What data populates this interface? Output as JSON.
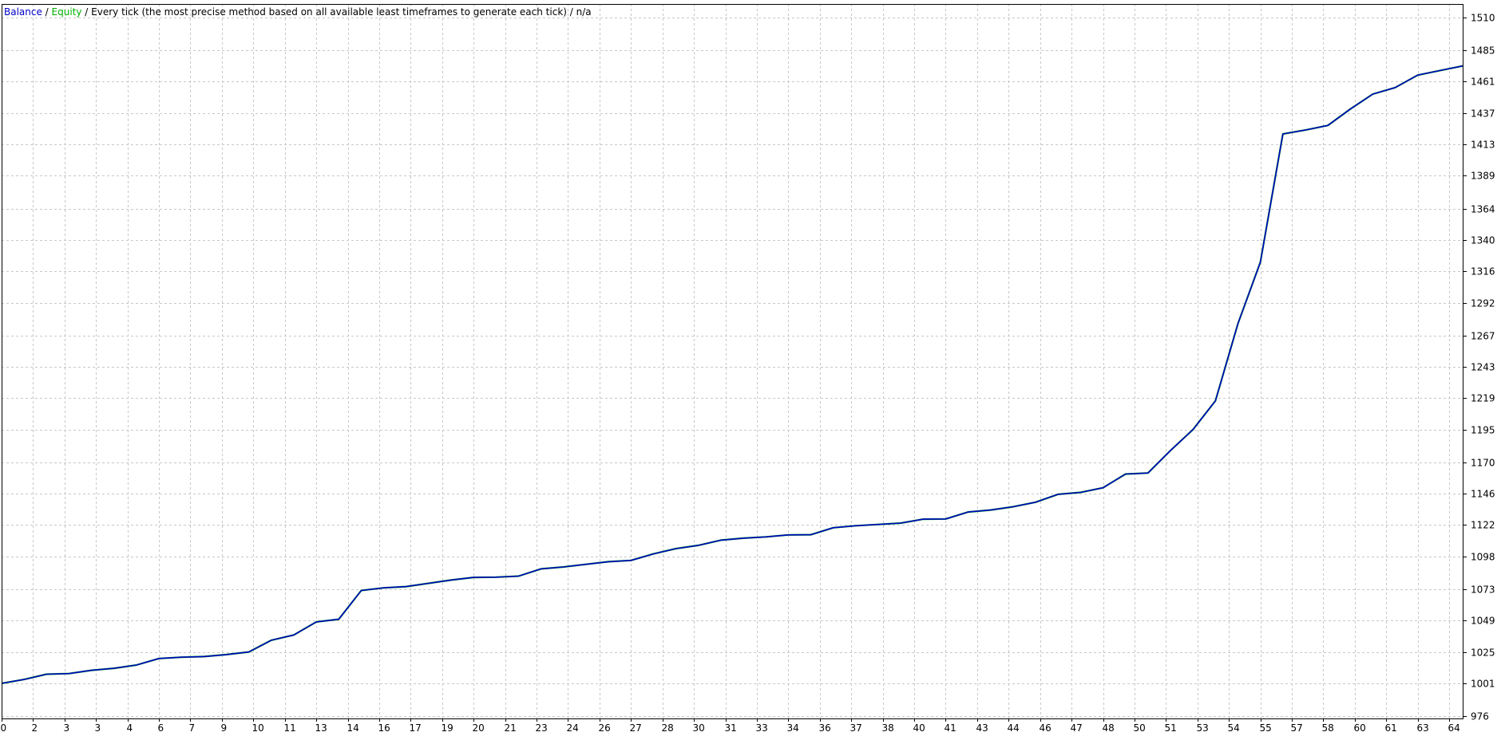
{
  "legend": {
    "balance_label": "Balance",
    "equity_label": "Equity",
    "separator": " / ",
    "model_text": "Every tick (the most precise method based on all available least timeframes to generate each tick)",
    "suffix": "n/a"
  },
  "colors": {
    "balance": "#0000c8",
    "equity": "#00b000",
    "grid": "#c8c8c8",
    "axis": "#000000",
    "background": "#ffffff",
    "text": "#000000"
  },
  "chart_data": {
    "type": "line",
    "grid": true,
    "xlim": [
      0,
      65
    ],
    "ylim": [
      976,
      1522
    ],
    "y_ticks": [
      976,
      1001,
      1025,
      1049,
      1073,
      1098,
      1122,
      1146,
      1170,
      1195,
      1219,
      1243,
      1267,
      1292,
      1316,
      1340,
      1364,
      1389,
      1413,
      1437,
      1461,
      1485,
      1510
    ],
    "x_tick_labels": [
      "0",
      "2",
      "3",
      "3",
      "4",
      "6",
      "7",
      "9",
      "10",
      "11",
      "13",
      "14",
      "16",
      "17",
      "19",
      "20",
      "21",
      "23",
      "24",
      "26",
      "27",
      "28",
      "30",
      "31",
      "33",
      "34",
      "36",
      "37",
      "38",
      "40",
      "41",
      "43",
      "44",
      "46",
      "47",
      "48",
      "50",
      "51",
      "53",
      "54",
      "55",
      "57",
      "58",
      "60",
      "61",
      "63",
      "64"
    ],
    "x_tick_positions": [
      0,
      1.4,
      2.8,
      4.2,
      5.6,
      7.0,
      8.4,
      9.8,
      11.2,
      12.6,
      14.0,
      15.4,
      16.8,
      18.2,
      19.6,
      21.0,
      22.4,
      23.8,
      25.2,
      26.6,
      28.0,
      29.4,
      30.8,
      32.2,
      33.6,
      35.0,
      36.4,
      37.8,
      39.2,
      40.6,
      42.0,
      43.4,
      44.8,
      46.2,
      47.6,
      49.0,
      50.4,
      51.8,
      53.2,
      54.6,
      56.0,
      57.4,
      58.8,
      60.2,
      61.6,
      63.0,
      64.4
    ],
    "series": [
      {
        "name": "Balance",
        "x": [
          0,
          1,
          2,
          3,
          4,
          5,
          6,
          7,
          8,
          9,
          10,
          11,
          12,
          13,
          14,
          15,
          16,
          17,
          18,
          19,
          20,
          21,
          22,
          23,
          24,
          25,
          26,
          27,
          28,
          29,
          30,
          31,
          32,
          33,
          34,
          35,
          36,
          37,
          38,
          39,
          40,
          41,
          42,
          43,
          44,
          45,
          46,
          47,
          48,
          49,
          50,
          51,
          52,
          53,
          54,
          55,
          56,
          57,
          58,
          59,
          60,
          61,
          62,
          63,
          64,
          65
        ],
        "values": [
          1001,
          1004,
          1008,
          1008.5,
          1011,
          1012.5,
          1015,
          1020,
          1021,
          1021.5,
          1023,
          1025,
          1034,
          1038,
          1048,
          1050,
          1072,
          1074,
          1075,
          1077.5,
          1080,
          1082,
          1082.2,
          1083,
          1088.5,
          1090,
          1092,
          1094,
          1095,
          1100,
          1104,
          1106.5,
          1110.5,
          1112,
          1113,
          1114.5,
          1114.6,
          1120,
          1121.5,
          1122.5,
          1123.5,
          1126.5,
          1126.7,
          1132,
          1133.5,
          1136,
          1139.5,
          1145.5,
          1147,
          1150.5,
          1161,
          1161.8,
          1179,
          1195,
          1217,
          1276,
          1323,
          1421,
          1424,
          1427.5,
          1440,
          1451.5,
          1456.5,
          1466,
          1469.5,
          1473
        ]
      }
    ]
  }
}
